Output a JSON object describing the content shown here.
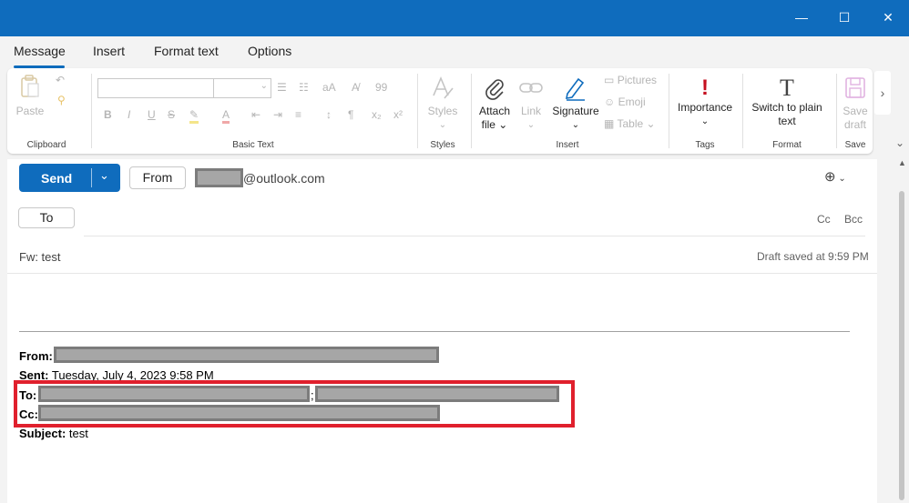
{
  "window": {
    "minimize": "—",
    "maximize": "☐",
    "close": "✕"
  },
  "tabs": [
    {
      "label": "Message",
      "active": true
    },
    {
      "label": "Insert"
    },
    {
      "label": "Format text"
    },
    {
      "label": "Options"
    }
  ],
  "ribbon": {
    "clipboard": {
      "paste": "Paste",
      "group": "Clipboard"
    },
    "basic_text": {
      "group": "Basic Text",
      "bold": "B",
      "italic": "I",
      "underline": "U",
      "strike": "S",
      "subscript": "x₂",
      "superscript": "x²",
      "font_size": "aA",
      "styles_quote": "99"
    },
    "styles": {
      "label": "Styles",
      "group": "Styles"
    },
    "insert": {
      "attach": "Attach",
      "attach_sub": "file",
      "link": "Link",
      "signature": "Signature",
      "pictures": "Pictures",
      "emoji": "Emoji",
      "table": "Table",
      "group": "Insert"
    },
    "tags": {
      "importance": "Importance",
      "group": "Tags"
    },
    "format": {
      "switch1": "Switch to plain",
      "switch2": "text",
      "group": "Format"
    },
    "save": {
      "save1": "Save",
      "save2": "draft",
      "group": "Save"
    }
  },
  "compose": {
    "send": "Send",
    "from_button": "From",
    "from_domain": "@outlook.com",
    "to_button": "To",
    "cc": "Cc",
    "bcc": "Bcc",
    "subject": "Fw: test",
    "draft_status": "Draft saved at 9:59 PM"
  },
  "forwarded": {
    "from_label": "From:",
    "sent_label": "Sent:",
    "sent_value": "Tuesday, July 4, 2023 9:58 PM",
    "to_label": "To:",
    "to_sep": ";",
    "cc_label": "Cc:",
    "subject_label": "Subject:",
    "subject_value": "test"
  },
  "colors": {
    "accent": "#0f6cbd",
    "highlight": "#e0202d",
    "importance": "#c50f1f"
  }
}
